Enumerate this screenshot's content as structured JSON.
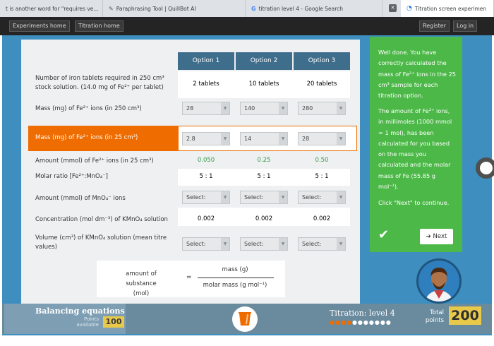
{
  "browser": {
    "tabs": [
      {
        "label": "t is another word for \"requires ve..."
      },
      {
        "label": "Paraphrasing Tool | QuillBot AI"
      },
      {
        "label": "titration level 4 - Google Search"
      },
      {
        "label": "Titration screen experimen"
      }
    ]
  },
  "nav": {
    "experiments_home": "Experiments home",
    "titration_home": "Titration home",
    "register": "Register",
    "login": "Log in"
  },
  "table": {
    "headers": [
      "Option 1",
      "Option 2",
      "Option 3"
    ],
    "rows": [
      {
        "label": "Number of iron tablets required in 250 cm³ stock solution. (14.0 mg of Fe²⁺ per tablet)",
        "values": [
          "2 tablets",
          "10 tablets",
          "20 tablets"
        ]
      },
      {
        "label": "Mass (mg) of Fe²⁺ ions (in 250 cm³)",
        "values": [
          "28",
          "140",
          "280"
        ]
      },
      {
        "label": "Mass (mg) of Fe²⁺ ions (in 25 cm³)",
        "values": [
          "2.8",
          "14",
          "28"
        ]
      },
      {
        "label": "Amount (mmol) of Fe²⁺ ions (in 25 cm³)",
        "values": [
          "0.050",
          "0.25",
          "0.50"
        ]
      },
      {
        "label": "Molar ratio [Fe²⁺:MnO₄⁻]",
        "values": [
          "5 : 1",
          "5 : 1",
          "5 : 1"
        ]
      },
      {
        "label": "Amount (mmol) of MnO₄⁻ ions",
        "values": [
          "Select:",
          "Select:",
          "Select:"
        ]
      },
      {
        "label": "Concentration (mol dm⁻³) of KMnO₄ solution",
        "values": [
          "0.002",
          "0.002",
          "0.002"
        ]
      },
      {
        "label": "Volume (cm³) of KMnO₄ solution (mean titre values)",
        "values": [
          "Select:",
          "Select:",
          "Select:"
        ]
      }
    ]
  },
  "formula": {
    "lhs_top": "amount of substance",
    "lhs_bottom": "(mol)",
    "equals": "=",
    "numerator": "mass (g)",
    "denominator": "molar mass (g mol⁻¹)"
  },
  "feedback": {
    "para1": "Well done. You have correctly calculated the mass of Fe²⁺ ions in the 25 cm³ sample for each titration option.",
    "para2": "The amount of Fe²⁺ ions, in millimoles (1000 mmol = 1 mol), has been calculated for you based on the mass you calculated and the molar mass of Fe (55.85 g mol⁻¹).",
    "para3": "Click \"Next\" to continue.",
    "next_label": "Next"
  },
  "footer": {
    "title": "Balancing equations",
    "points_label": "Points available",
    "points_value": "100",
    "level_label": "Titration: level 4",
    "total_label": "Total points",
    "total_value": "200",
    "progress_done": 4,
    "progress_total": 11
  },
  "colors": {
    "accent_orange": "#ef6c00",
    "header_blue": "#3f6d8c",
    "feedback_green": "#4cb848",
    "value_green": "#3a9b4a",
    "score_yellow": "#e9c94a"
  }
}
